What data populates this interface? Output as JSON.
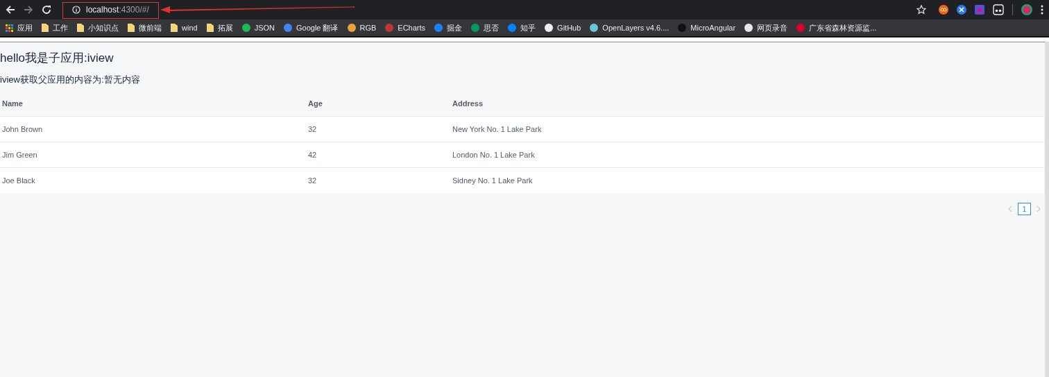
{
  "browser": {
    "address": {
      "host": "localhost",
      "rest": ":4300/#/"
    },
    "bookmarks": [
      {
        "kind": "apps",
        "label": "应用"
      },
      {
        "kind": "folder",
        "label": "工作"
      },
      {
        "kind": "folder",
        "label": "小知识点"
      },
      {
        "kind": "folder",
        "label": "微前端"
      },
      {
        "kind": "folder",
        "label": "wind"
      },
      {
        "kind": "folder",
        "label": "拓展"
      },
      {
        "kind": "site",
        "label": "JSON",
        "color": "#1db954"
      },
      {
        "kind": "site",
        "label": "Google 翻译",
        "color": "#4285f4"
      },
      {
        "kind": "site",
        "label": "RGB",
        "color": "#e8a23a"
      },
      {
        "kind": "site",
        "label": "ECharts",
        "color": "#c23531"
      },
      {
        "kind": "site",
        "label": "掘金",
        "color": "#1e80ff"
      },
      {
        "kind": "site",
        "label": "思否",
        "color": "#009a61"
      },
      {
        "kind": "site",
        "label": "知乎",
        "color": "#0084ff"
      },
      {
        "kind": "site",
        "label": "GitHub",
        "color": "#f0f0f0"
      },
      {
        "kind": "site",
        "label": "OpenLayers v4.6....",
        "color": "#6bc5d2"
      },
      {
        "kind": "site",
        "label": "MicroAngular",
        "color": "#111111"
      },
      {
        "kind": "site",
        "label": "网页录音",
        "color": "#e8e8e8"
      },
      {
        "kind": "site",
        "label": "广东省森林资源监...",
        "color": "#dd0031"
      }
    ]
  },
  "page": {
    "title": "hello我是子应用:iview",
    "subtitle": "iview获取父应用的内容为:暂无内容",
    "table": {
      "columns": [
        "Name",
        "Age",
        "Address"
      ],
      "rows": [
        [
          "John Brown",
          "32",
          "New York No. 1 Lake Park"
        ],
        [
          "Jim Green",
          "42",
          "London No. 1 Lake Park"
        ],
        [
          "Joe Black",
          "32",
          "Sidney No. 1 Lake Park"
        ]
      ]
    },
    "pagination": {
      "prev_disabled": true,
      "pages": [
        {
          "label": "1",
          "selected": true
        }
      ],
      "next_disabled": true
    }
  }
}
